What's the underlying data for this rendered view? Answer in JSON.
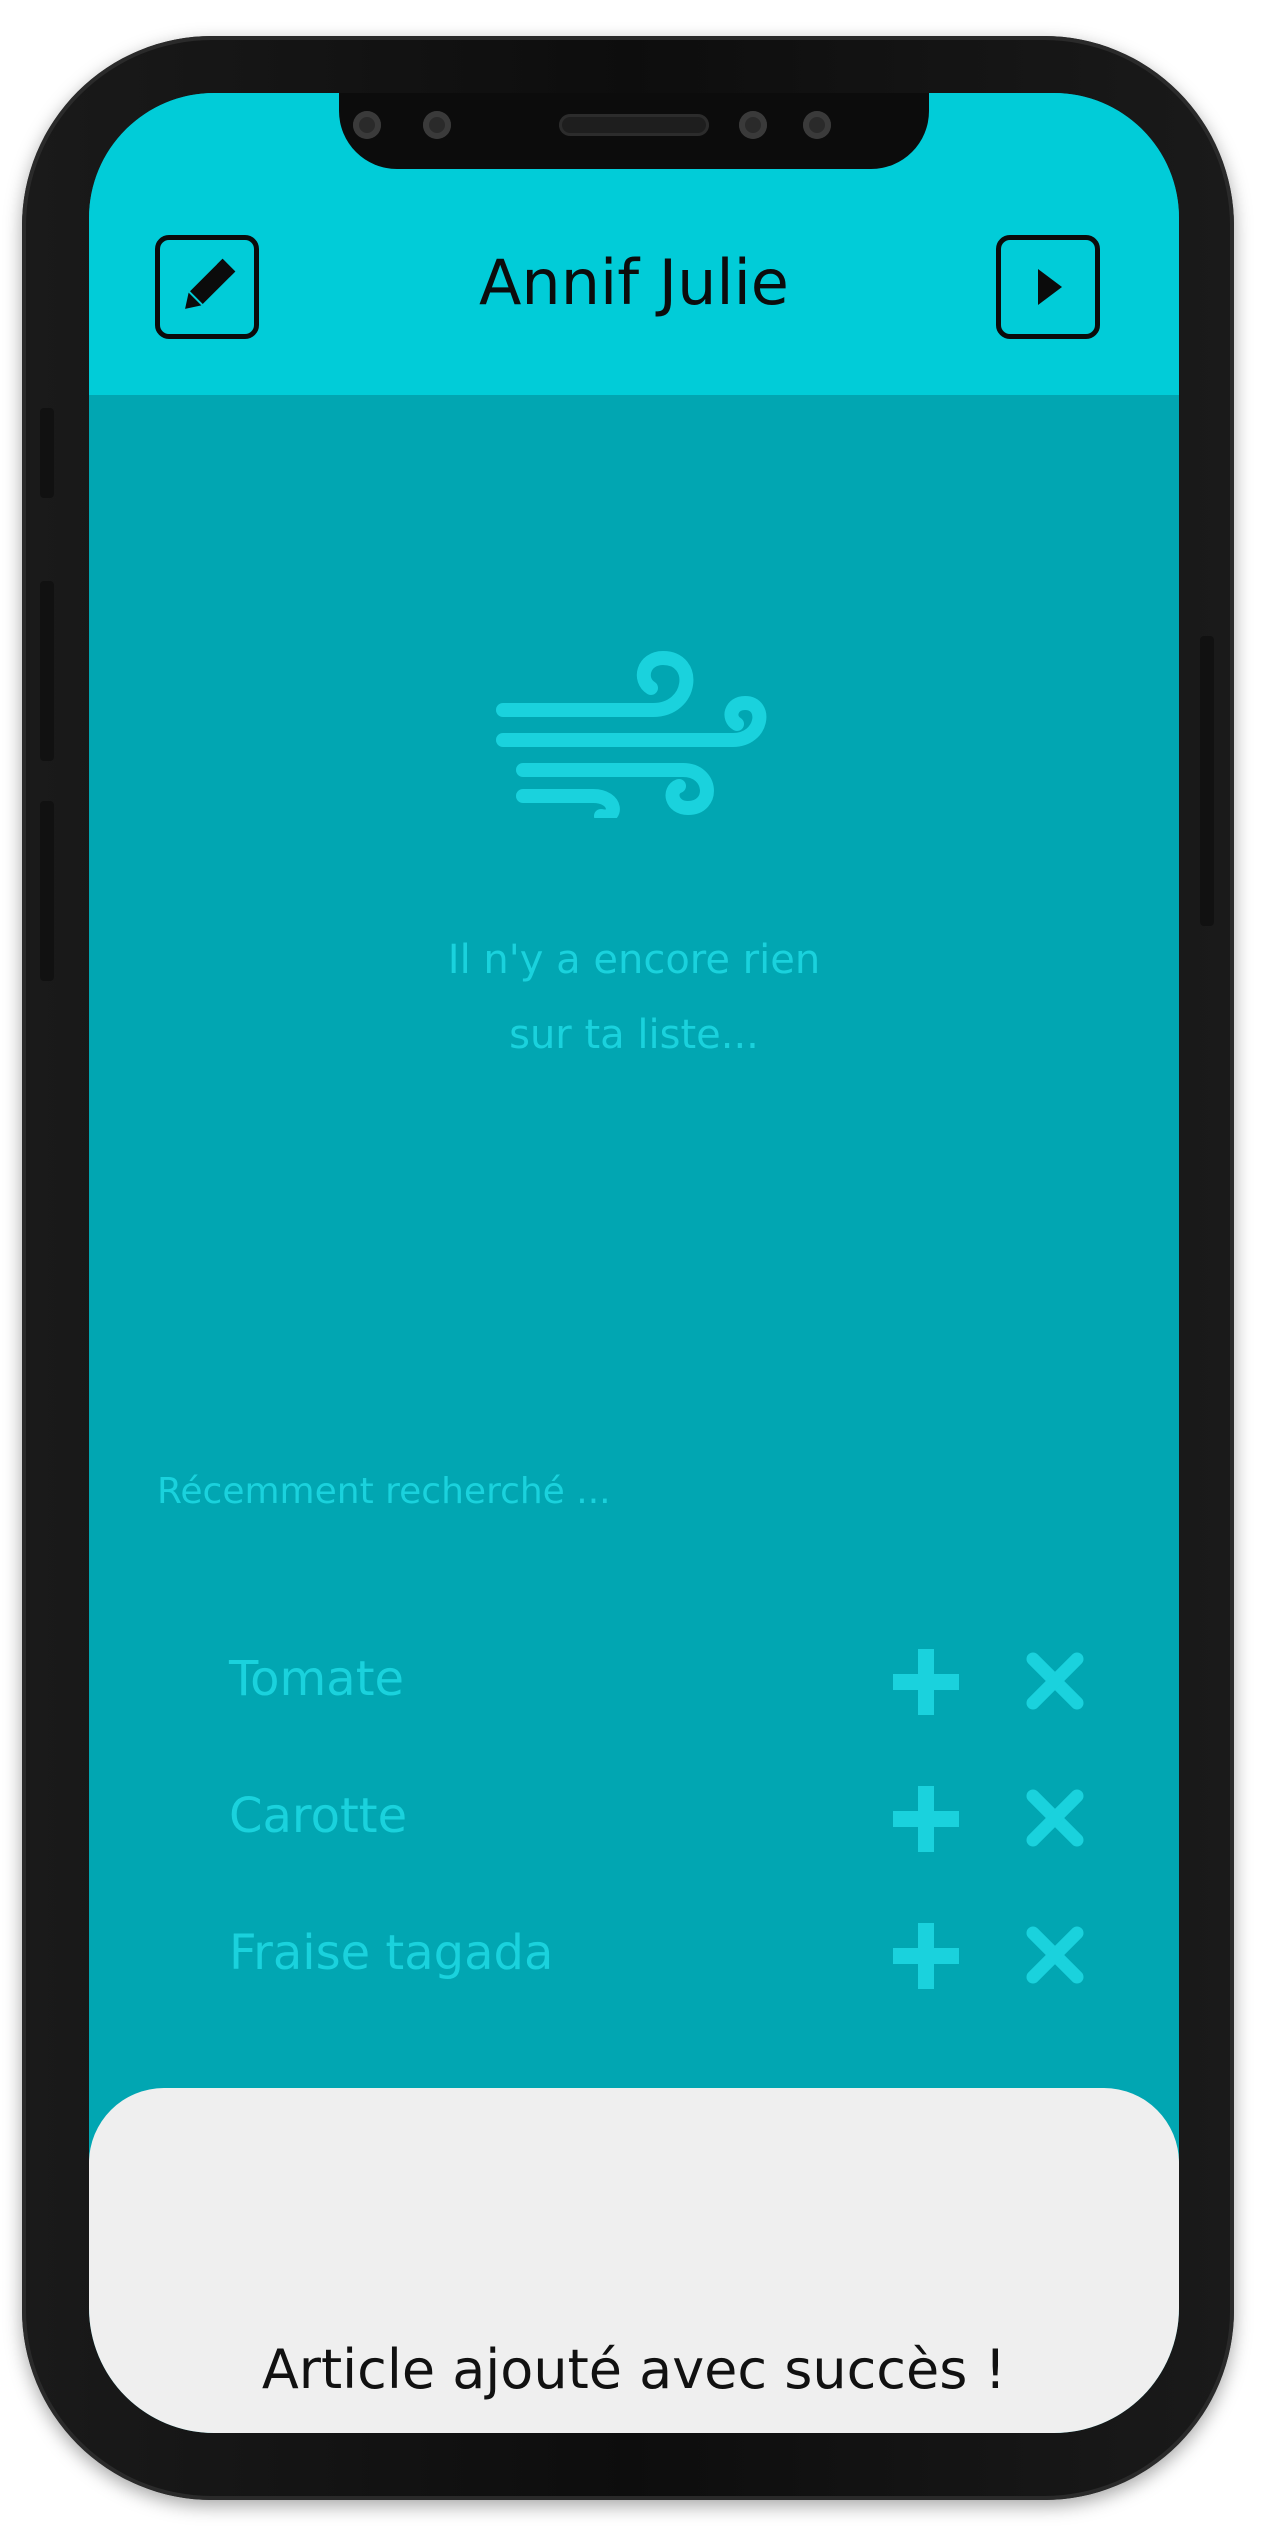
{
  "header": {
    "title": "Annif Julie",
    "edit_icon": "pencil-icon",
    "next_icon": "play-arrow-icon"
  },
  "empty_state": {
    "icon": "wind-icon",
    "line1": "Il n'y a encore rien",
    "line2": "sur ta liste..."
  },
  "recent": {
    "label": "Récemment recherché ...",
    "items": [
      {
        "name": "Tomate"
      },
      {
        "name": "Carotte"
      },
      {
        "name": "Fraise tagada"
      }
    ],
    "add_icon": "plus-icon",
    "remove_icon": "close-icon"
  },
  "toast": {
    "message": "Article ajouté avec succès !"
  },
  "colors": {
    "header_bg": "#01ccd8",
    "body_bg": "#01a6b2",
    "accent": "#1ad2dd",
    "toast_bg": "#efefef"
  }
}
